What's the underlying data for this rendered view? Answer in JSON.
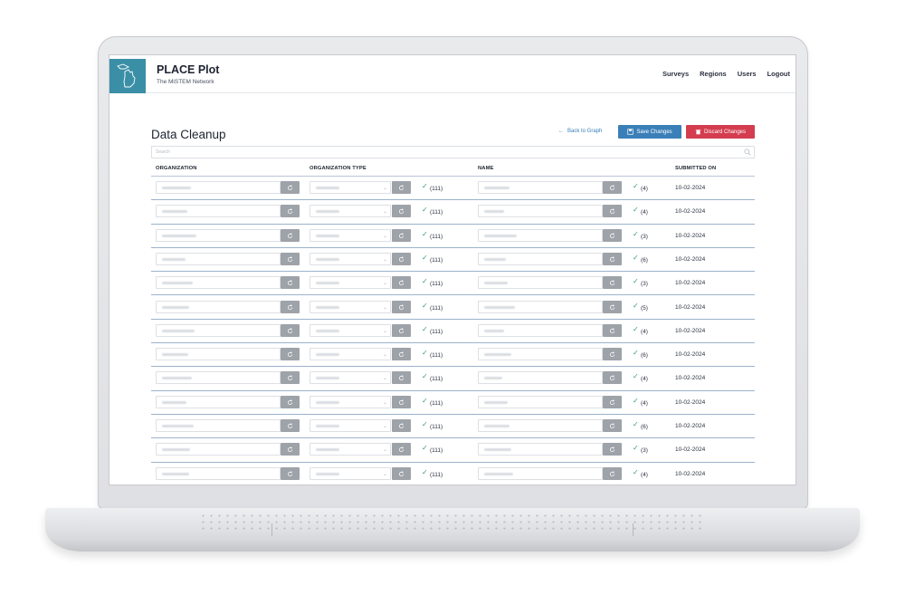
{
  "app": {
    "title": "PLACE Plot",
    "subtitle": "The MiSTEM Network",
    "nav": [
      "Surveys",
      "Regions",
      "Users",
      "Logout"
    ]
  },
  "page": {
    "title": "Data Cleanup",
    "back_link": "Back to Graph",
    "save_label": "Save Changes",
    "discard_label": "Discard Changes",
    "search_placeholder": "Search"
  },
  "table": {
    "headers": {
      "organization": "ORGANIZATION",
      "organization_type": "ORGANIZATION TYPE",
      "name": "NAME",
      "submitted_on": "SUBMITTED ON"
    },
    "rows": [
      {
        "org_count": "(111)",
        "name_count": "(4)",
        "date": "10-02-2024"
      },
      {
        "org_count": "(111)",
        "name_count": "(4)",
        "date": "10-02-2024"
      },
      {
        "org_count": "(111)",
        "name_count": "(3)",
        "date": "10-02-2024"
      },
      {
        "org_count": "(111)",
        "name_count": "(6)",
        "date": "10-02-2024"
      },
      {
        "org_count": "(111)",
        "name_count": "(3)",
        "date": "10-02-2024"
      },
      {
        "org_count": "(111)",
        "name_count": "(5)",
        "date": "10-02-2024"
      },
      {
        "org_count": "(111)",
        "name_count": "(4)",
        "date": "10-02-2024"
      },
      {
        "org_count": "(111)",
        "name_count": "(6)",
        "date": "10-02-2024"
      },
      {
        "org_count": "(111)",
        "name_count": "(4)",
        "date": "10-02-2024"
      },
      {
        "org_count": "(111)",
        "name_count": "(4)",
        "date": "10-02-2024"
      },
      {
        "org_count": "(111)",
        "name_count": "(6)",
        "date": "10-02-2024"
      },
      {
        "org_count": "(111)",
        "name_count": "(3)",
        "date": "10-02-2024"
      },
      {
        "org_count": "(111)",
        "name_count": "(4)",
        "date": "10-02-2024"
      }
    ]
  },
  "colors": {
    "brand": "#3a8fa6",
    "save": "#3b7fb8",
    "discard": "#d43d4f",
    "check": "#3a9a74"
  },
  "icons": {
    "logo": "michigan-map-icon",
    "back": "arrow-left-icon",
    "save": "save-icon",
    "discard": "trash-icon",
    "search": "search-icon",
    "reset": "refresh-icon",
    "confirm": "check-icon",
    "dropdown": "chevron-down-icon"
  }
}
